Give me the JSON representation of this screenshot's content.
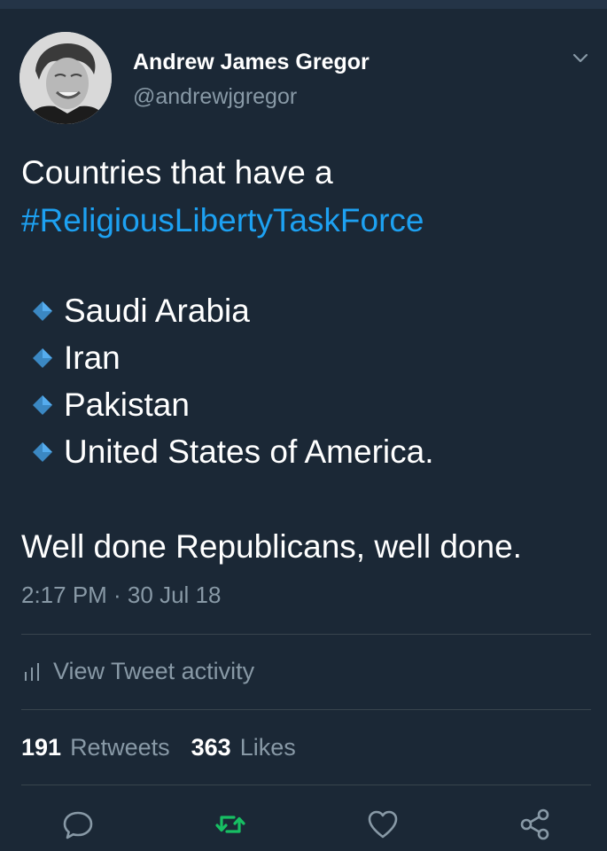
{
  "tweet": {
    "author_name": "Andrew James Gregor",
    "author_handle": "@andrewjgregor",
    "text_line1": "Countries that have a",
    "hashtag": "#ReligiousLibertyTaskForce",
    "countries": [
      "Saudi Arabia",
      "Iran",
      "Pakistan",
      "United States of America."
    ],
    "closing": "Well done Republicans, well done.",
    "timestamp": "2:17 PM · 30 Jul 18"
  },
  "activity": {
    "label": "View Tweet activity"
  },
  "stats": {
    "retweets_count": "191",
    "retweets_label": "Retweets",
    "likes_count": "363",
    "likes_label": "Likes"
  },
  "actions": {
    "icons": [
      "reply-icon",
      "retweet-icon",
      "like-icon",
      "share-icon"
    ],
    "retweet_color": "#17bf63",
    "default_color": "#8899a6"
  },
  "colors": {
    "background": "#1b2836",
    "hashtag": "#1da1f2",
    "muted": "#8899a6",
    "divider": "#38444d"
  }
}
